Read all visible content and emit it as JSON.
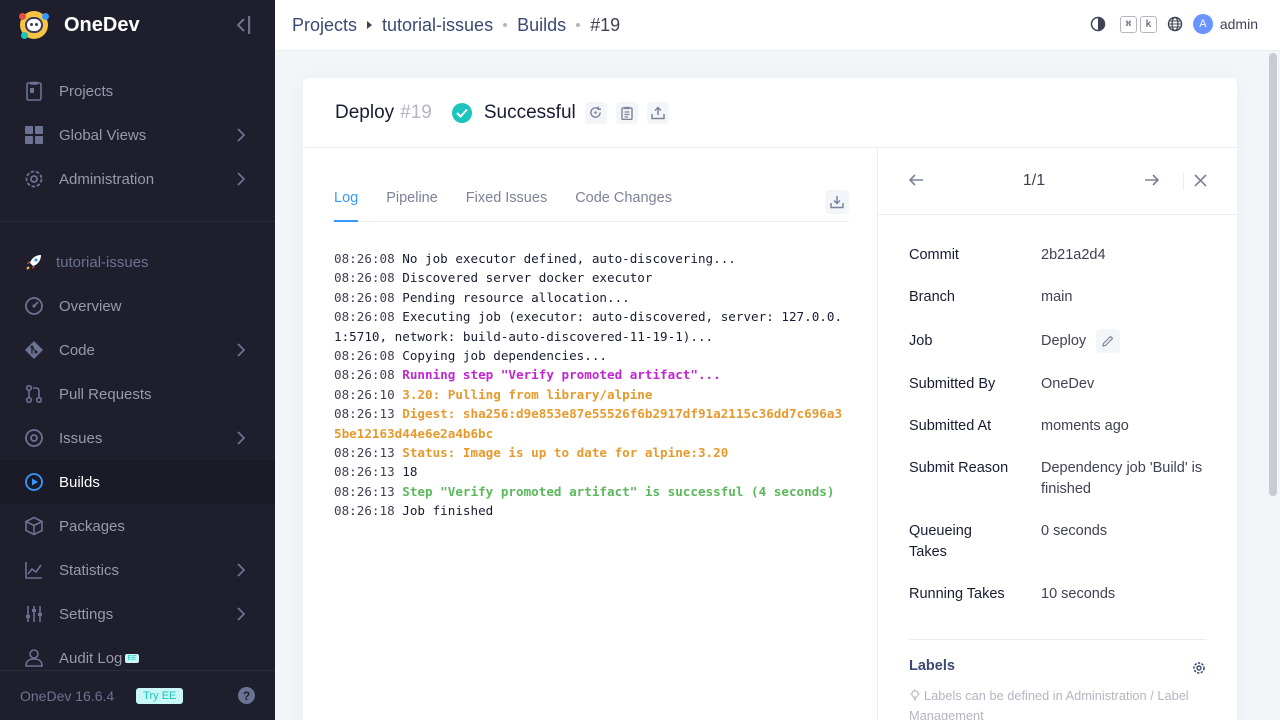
{
  "app": {
    "name": "OneDev",
    "version": "OneDev 16.6.4",
    "try_ee": "Try EE",
    "ee_badge": "EE"
  },
  "sidebar": {
    "global_items": [
      {
        "label": "Projects",
        "icon": "projects-icon"
      },
      {
        "label": "Global Views",
        "icon": "global-views-icon"
      },
      {
        "label": "Administration",
        "icon": "administration-icon"
      }
    ],
    "project_name": "tutorial-issues",
    "project_items": [
      {
        "label": "Overview"
      },
      {
        "label": "Code"
      },
      {
        "label": "Pull Requests"
      },
      {
        "label": "Issues"
      },
      {
        "label": "Builds"
      },
      {
        "label": "Packages"
      },
      {
        "label": "Statistics"
      },
      {
        "label": "Settings"
      },
      {
        "label": "Audit Log"
      }
    ]
  },
  "breadcrumb": [
    "Projects",
    "tutorial-issues",
    "Builds",
    "#19"
  ],
  "topbar": {
    "kbd_cmd": "⌘",
    "kbd_k": "k",
    "avatar_letter": "A",
    "user": "admin"
  },
  "build": {
    "job": "Deploy",
    "number": "#19",
    "status": "Successful",
    "status_color": "#1bc5bd"
  },
  "tabs": [
    "Log",
    "Pipeline",
    "Fixed Issues",
    "Code Changes"
  ],
  "log": [
    {
      "ts": "08:26:08",
      "text": "No job executor defined, auto-discovering..."
    },
    {
      "ts": "08:26:08",
      "text": "Discovered server docker executor"
    },
    {
      "ts": "08:26:08",
      "text": "Pending resource allocation..."
    },
    {
      "ts": "08:26:08",
      "text": "Executing job (executor: auto-discovered, server: 127.0.0.1:5710, network: build-auto-discovered-11-19-1)..."
    },
    {
      "ts": "08:26:08",
      "text": "Copying job dependencies..."
    },
    {
      "ts": "08:26:08",
      "text": "Running step \"Verify promoted artifact\"..."
    },
    {
      "ts": "08:26:10",
      "text": "3.20: Pulling from library/alpine"
    },
    {
      "ts": "08:26:13",
      "text": "Digest: sha256:d9e853e87e55526f6b2917df91a2115c36dd7c696a35be12163d44e6e2a4b6bc"
    },
    {
      "ts": "08:26:13",
      "text": "Status: Image is up to date for alpine:3.20"
    },
    {
      "ts": "08:26:13",
      "text": "18"
    },
    {
      "ts": "08:26:13",
      "text": "Step \"Verify promoted artifact\" is successful (4 seconds)"
    },
    {
      "ts": "08:26:18",
      "text": "Job finished"
    }
  ],
  "pager": {
    "count": "1/1"
  },
  "props": [
    {
      "key": "Commit",
      "value": "2b21a2d4"
    },
    {
      "key": "Branch",
      "value": "main"
    },
    {
      "key": "Job",
      "value": "Deploy"
    },
    {
      "key": "Submitted By",
      "value": "OneDev"
    },
    {
      "key": "Submitted At",
      "value": "moments ago"
    },
    {
      "key": "Submit Reason",
      "value": "Dependency job 'Build' is finished"
    },
    {
      "key": "Queueing Takes",
      "value": "0 seconds"
    },
    {
      "key": "Running Takes",
      "value": "10 seconds"
    }
  ],
  "labels": {
    "title": "Labels",
    "hint": "Labels can be defined in Administration / Label Management"
  }
}
